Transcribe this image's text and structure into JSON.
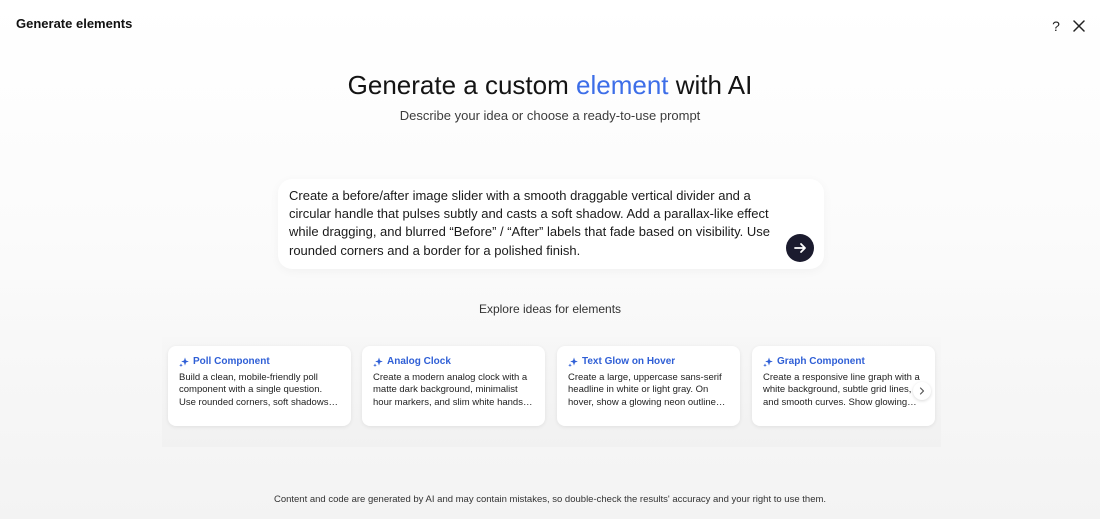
{
  "panel": {
    "title": "Generate elements"
  },
  "hero": {
    "title_before": "Generate a custom ",
    "title_accent": "element",
    "title_after": " with AI",
    "subtitle": "Describe your idea or choose a ready-to-use prompt"
  },
  "prompt": {
    "value": "Create a before/after image slider with a smooth draggable vertical divider and a circular handle that pulses subtly and casts a soft shadow. Add a parallax-like effect while dragging, and blurred “Before” / “After” labels that fade based on visibility. Use rounded corners and a border for a polished finish."
  },
  "explore": {
    "title": "Explore ideas for elements",
    "cards": [
      {
        "title": "Poll Component",
        "description": "Build a clean, mobile-friendly poll component with a single question. Use rounded corners, soft shadows, and smooth animations."
      },
      {
        "title": "Analog Clock",
        "description": "Create a modern analog clock with a matte dark background, minimalist hour markers, and slim white hands that tick smoothly."
      },
      {
        "title": "Text Glow on Hover",
        "description": "Create a large, uppercase sans-serif headline in white or light gray. On hover, show a glowing neon outline effect."
      },
      {
        "title": "Graph Component",
        "description": "Create a responsive line graph with a white background, subtle grid lines, and smooth curves. Show glowing data points."
      }
    ]
  },
  "footer": {
    "note": "Content and code are generated by AI and may contain mistakes, so double-check the results' accuracy and your right to use them."
  },
  "icons": {
    "help": "?",
    "close": "close-icon",
    "send": "arrow-right-icon",
    "sparkle": "sparkle-icon",
    "next": "chevron-right-icon"
  },
  "colors": {
    "accent": "#3d6ee8",
    "card_title": "#2f5fd6",
    "send_button": "#1b1b2e"
  }
}
